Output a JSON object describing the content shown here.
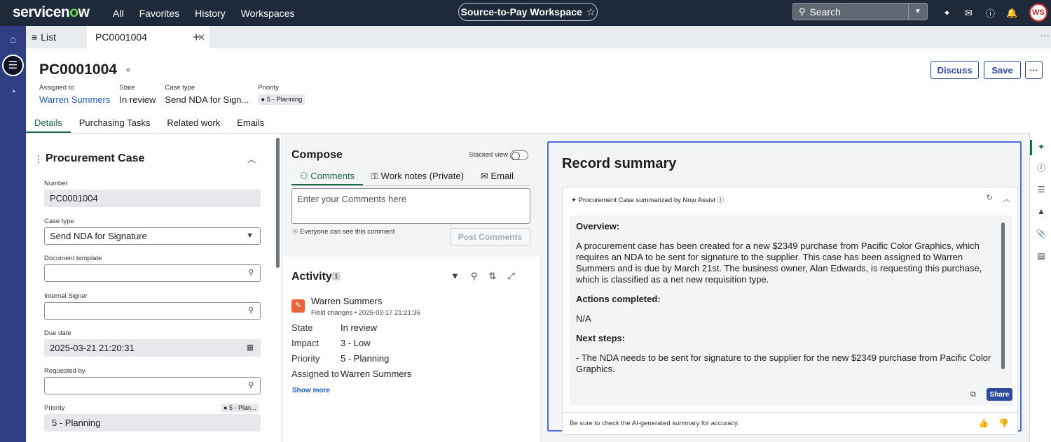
{
  "topbar": {
    "logo_prefix": "servicen",
    "logo_o": "o",
    "logo_suffix": "w",
    "nav": [
      "All",
      "Favorites",
      "History",
      "Workspaces"
    ],
    "workspace": "Source-to-Pay Workspace",
    "search_label": "Search",
    "avatar_initials": "WS"
  },
  "tabs": {
    "list_label": "List",
    "record_tab": "PC0001004"
  },
  "header": {
    "title": "PC0001004",
    "fields": {
      "assigned_label": "Assigned to",
      "assigned_value": "Warren Summers",
      "state_label": "State",
      "state_value": "In review",
      "case_type_label": "Case type",
      "case_type_value": "Send NDA for Sign...",
      "priority_label": "Priority",
      "priority_value": "5 - Planning"
    },
    "buttons": {
      "discuss": "Discuss",
      "save": "Save",
      "more": "···"
    },
    "subtabs": [
      "Details",
      "Purchasing Tasks",
      "Related work",
      "Emails"
    ]
  },
  "form": {
    "section_title": "Procurement Case",
    "number_label": "Number",
    "number_value": "PC0001004",
    "case_type_label": "Case type",
    "case_type_value": "Send NDA for Signature",
    "doc_template_label": "Document template",
    "internal_signer_label": "Internal Signer",
    "due_date_label": "Due date",
    "due_date_value": "2025-03-21 21:20:31",
    "requested_by_label": "Requested by",
    "priority_label": "Priority",
    "priority_badge": "5 - Plan...",
    "priority_value": "5 - Planning"
  },
  "compose": {
    "title": "Compose",
    "stacked_label": "Stacked view",
    "tab_comments": "Comments",
    "tab_worknotes": "Work notes (Private)",
    "tab_email": "Email",
    "placeholder": "Enter your Comments here",
    "visibility": "Everyone can see this comment",
    "post_label": "Post Comments"
  },
  "activity": {
    "title": "Activity",
    "count": "1",
    "entry": {
      "author": "Warren Summers",
      "type": "Field changes",
      "timestamp": "2025-03-17 21:21:36",
      "rows": [
        {
          "key": "State",
          "value": "In review"
        },
        {
          "key": "Impact",
          "value": "3 - Low"
        },
        {
          "key": "Priority",
          "value": "5 - Planning"
        },
        {
          "key": "Assigned to",
          "value": "Warren Summers"
        }
      ]
    },
    "show_more": "Show more"
  },
  "summary": {
    "title": "Record summary",
    "card_header": "Procurement Case summarized by Now Assist",
    "overview_h": "Overview:",
    "overview": "A procurement case has been created for a new $2349 purchase from Pacific Color Graphics, which requires an NDA to be sent for signature to the supplier. This case has been assigned to Warren Summers and is due by March 21st. The business owner, Alan Edwards, is requesting this purchase, which is classified as a net new requisition type.",
    "actions_h": "Actions completed:",
    "actions": "N/A",
    "next_h": "Next steps:",
    "next": "- The NDA needs to be sent for signature to the supplier for the new $2349 purchase from Pacific Color Graphics.",
    "share_label": "Share",
    "footer": "Be sure to check the AI-generated summary for accuracy."
  },
  "colors": {
    "topbar": "#1e2a3a",
    "rail": "#2f3d82",
    "accent": "#1e6b4a",
    "primary": "#2e4a9c",
    "highlight": "#4e6ce0"
  }
}
